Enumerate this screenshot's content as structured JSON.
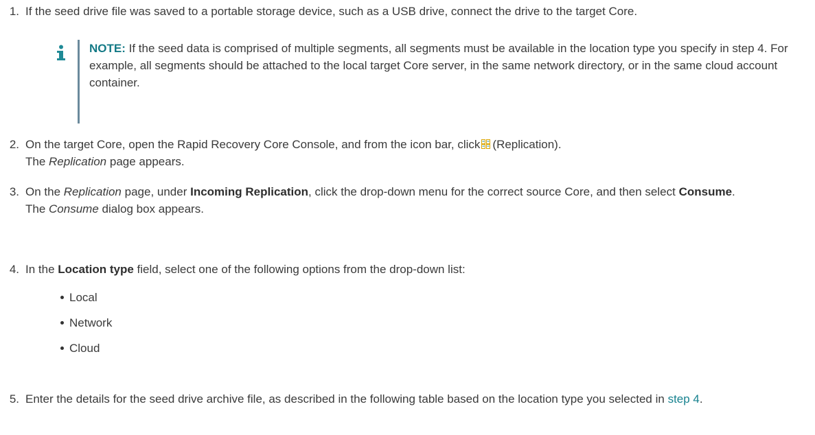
{
  "steps": [
    {
      "num": "1.",
      "text": "If the seed drive file was saved to a portable storage device, such as a USB drive, connect the drive to the target Core."
    },
    {
      "num": "2.",
      "t1": "On the target Core, open the Rapid Recovery Core Console, and from the icon bar, click",
      "t2": "(Replication).",
      "t3": "The",
      "t4": "Replication",
      "t5": "page appears.",
      "icon": "replication-icon"
    },
    {
      "num": "3.",
      "t1": "On the",
      "t2": "Replication",
      "t3": "page, under",
      "t4": "Incoming Replication",
      "t5": ", click the drop-down menu for the correct source Core, and then select",
      "t6": "Consume",
      "t7": ".",
      "t8": "The",
      "t9": "Consume",
      "t10": "dialog box appears."
    },
    {
      "num": "4.",
      "t1": "In the",
      "t2": "Location type",
      "t3": "field, select one of the following options from the drop-down list:",
      "options": [
        "Local",
        "Network",
        "Cloud"
      ]
    },
    {
      "num": "5.",
      "t1": "Enter the details for the seed drive archive file, as described in the following table based on the location type you selected in",
      "t2": "step 4",
      "t3": "."
    }
  ],
  "note": {
    "label": "NOTE:",
    "text": "If the seed data is comprised of multiple segments, all segments must be available in the location type you specify in step 4. For example, all segments should be attached to the local target Core server, in the same network directory, or in the same cloud account container.",
    "icon": "info-icon"
  },
  "colors": {
    "note_label": "#147a86",
    "link": "#17828f",
    "note_bar": "#6b8a9c",
    "icon": "#1f8a96"
  }
}
